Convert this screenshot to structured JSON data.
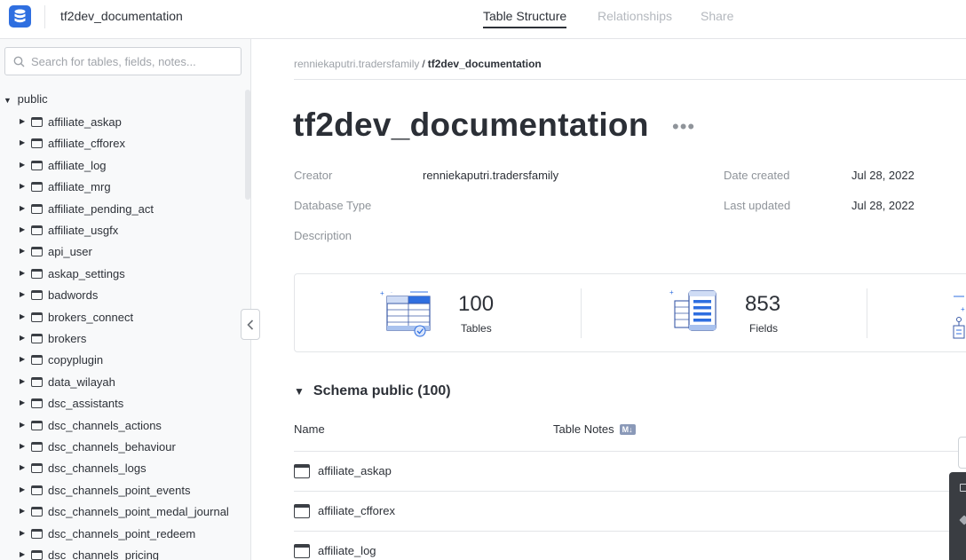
{
  "header": {
    "db_name": "tf2dev_documentation",
    "tabs": [
      {
        "label": "Table Structure",
        "active": true
      },
      {
        "label": "Relationships",
        "active": false
      },
      {
        "label": "Share",
        "active": false
      }
    ]
  },
  "sidebar": {
    "search_placeholder": "Search for tables, fields, notes...",
    "schema": "public",
    "tables": [
      "affiliate_askap",
      "affiliate_cfforex",
      "affiliate_log",
      "affiliate_mrg",
      "affiliate_pending_act",
      "affiliate_usgfx",
      "api_user",
      "askap_settings",
      "badwords",
      "brokers_connect",
      "brokers",
      "copyplugin",
      "data_wilayah",
      "dsc_assistants",
      "dsc_channels_actions",
      "dsc_channels_behaviour",
      "dsc_channels_logs",
      "dsc_channels_point_events",
      "dsc_channels_point_medal_journal",
      "dsc_channels_point_redeem",
      "dsc_channels_pricing"
    ]
  },
  "breadcrumb": {
    "owner": "renniekaputri.tradersfamily",
    "separator": "/",
    "current": "tf2dev_documentation"
  },
  "doc": {
    "title": "tf2dev_documentation",
    "more": "•••",
    "meta": {
      "creator_label": "Creator",
      "creator_value": "renniekaputri.tradersfamily",
      "db_type_label": "Database Type",
      "description_label": "Description",
      "date_created_label": "Date created",
      "date_created_value": "Jul 28, 2022",
      "last_updated_label": "Last updated",
      "last_updated_value": "Jul 28, 2022"
    }
  },
  "stats": {
    "tables_count": "100",
    "tables_label": "Tables",
    "fields_count": "853",
    "fields_label": "Fields"
  },
  "schema_section": {
    "title": "Schema public (100)",
    "col_name": "Name",
    "col_notes": "Table Notes",
    "md_badge": "M↓",
    "rows": [
      "affiliate_askap",
      "affiliate_cfforex",
      "affiliate_log"
    ]
  },
  "colors": {
    "accent": "#2f6fe0",
    "text": "#2d3138",
    "muted": "#8f949a"
  },
  "icons": {
    "logo": "database-icon",
    "search": "search-icon",
    "table": "table-icon",
    "collapse": "chevron-left-icon"
  }
}
